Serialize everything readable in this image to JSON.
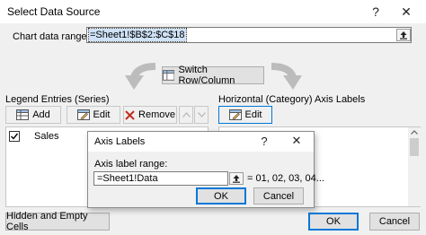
{
  "window": {
    "title": "Select Data Source",
    "help_glyph": "?",
    "close_glyph": "✕"
  },
  "chart_range": {
    "label": "Chart data range:",
    "value": "=Sheet1!$B$2:$C$18"
  },
  "switch_button": {
    "label": "Switch Row/Column"
  },
  "legend": {
    "header": "Legend Entries (Series)",
    "add_label": "Add",
    "edit_label": "Edit",
    "remove_label": "Remove",
    "items": [
      {
        "label": "Sales",
        "checked": true
      }
    ]
  },
  "axis": {
    "header": "Horizontal (Category) Axis Labels",
    "edit_label": "Edit"
  },
  "bottom": {
    "hidden_empty_label": "Hidden and Empty Cells",
    "ok_label": "OK",
    "cancel_label": "Cancel"
  },
  "axis_dialog": {
    "title": "Axis Labels",
    "help_glyph": "?",
    "close_glyph": "✕",
    "range_label": "Axis label range:",
    "range_value": "=Sheet1!Data",
    "preview": "= 01, 02, 03, 04...",
    "ok_label": "OK",
    "cancel_label": "Cancel"
  },
  "colors": {
    "accent": "#0078d7",
    "remove_x": "#c42b1c",
    "selection": "#cfe2f7"
  }
}
